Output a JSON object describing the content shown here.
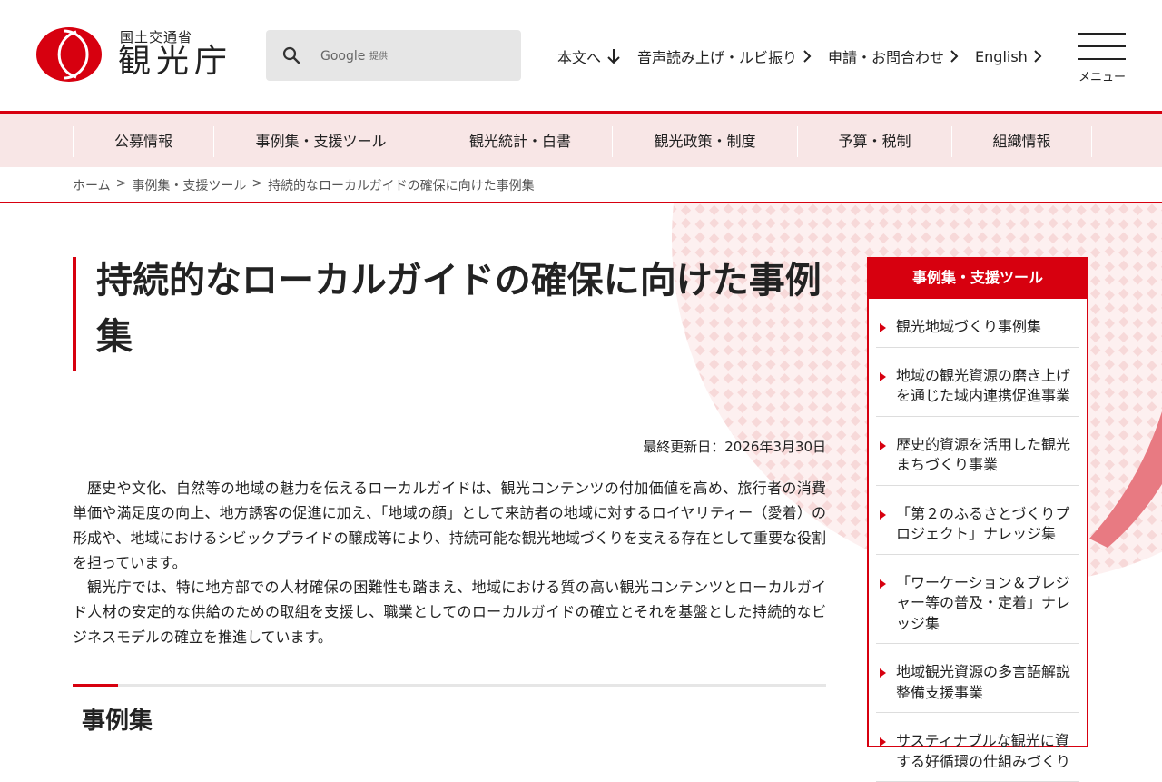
{
  "header": {
    "ministry": "国土交通省",
    "agency": "観光庁",
    "search_placeholder": "Google",
    "search_suffix": "提供",
    "util_links": [
      {
        "label": "本文へ",
        "icon": "arrow-down-icon"
      },
      {
        "label": "音声読み上げ・ルビ振り",
        "icon": "chevron-right-icon"
      },
      {
        "label": "申請・お問合わせ",
        "icon": "chevron-right-icon"
      },
      {
        "label": "English",
        "icon": "chevron-right-icon"
      }
    ],
    "menu_label": "メニュー"
  },
  "main_nav": [
    "公募情報",
    "事例集・支援ツール",
    "観光統計・白書",
    "観光政策・制度",
    "予算・税制",
    "組織情報"
  ],
  "breadcrumb": [
    "ホーム",
    "事例集・支援ツール",
    "持続的なローカルガイドの確保に向けた事例集"
  ],
  "breadcrumb_sep": ">",
  "page": {
    "title": "持続的なローカルガイドの確保に向けた事例集",
    "updated": "最終更新日：2026年3月30日",
    "paragraphs": [
      "歴史や文化、自然等の地域の魅力を伝えるローカルガイドは、観光コンテンツの付加価値を高め、旅行者の消費単価や満足度の向上、地方誘客の促進に加え、「地域の顔」として来訪者の地域に対するロイヤリティー（愛着）の形成や、地域におけるシビックプライドの醸成等により、持続可能な観光地域づくりを支える存在として重要な役割を担っています。",
      "観光庁では、特に地方部での人材確保の困難性も踏まえ、地域における質の高い観光コンテンツとローカルガイド人材の安定的な供給のための取組を支援し、職業としてのローカルガイドの確立とそれを基盤とした持続的なビジネスモデルの確立を推進しています。"
    ],
    "section_title": "事例集"
  },
  "sidebar": {
    "heading": "事例集・支援ツール",
    "items": [
      "観光地域づくり事例集",
      "地域の観光資源の磨き上げを通じた域内連携促進事業",
      "歴史的資源を活用した観光まちづくり事業",
      "「第２のふるさとづくりプロジェクト」ナレッジ集",
      "「ワーケーション＆ブレジャー等の普及・定着」ナレッジ集",
      "地域観光資源の多言語解説整備支援事業",
      "サスティナブルな観光に資する好循環の仕組みづくり"
    ]
  },
  "colors": {
    "accent": "#d7000f",
    "nav_bg": "#f8e6e6"
  }
}
